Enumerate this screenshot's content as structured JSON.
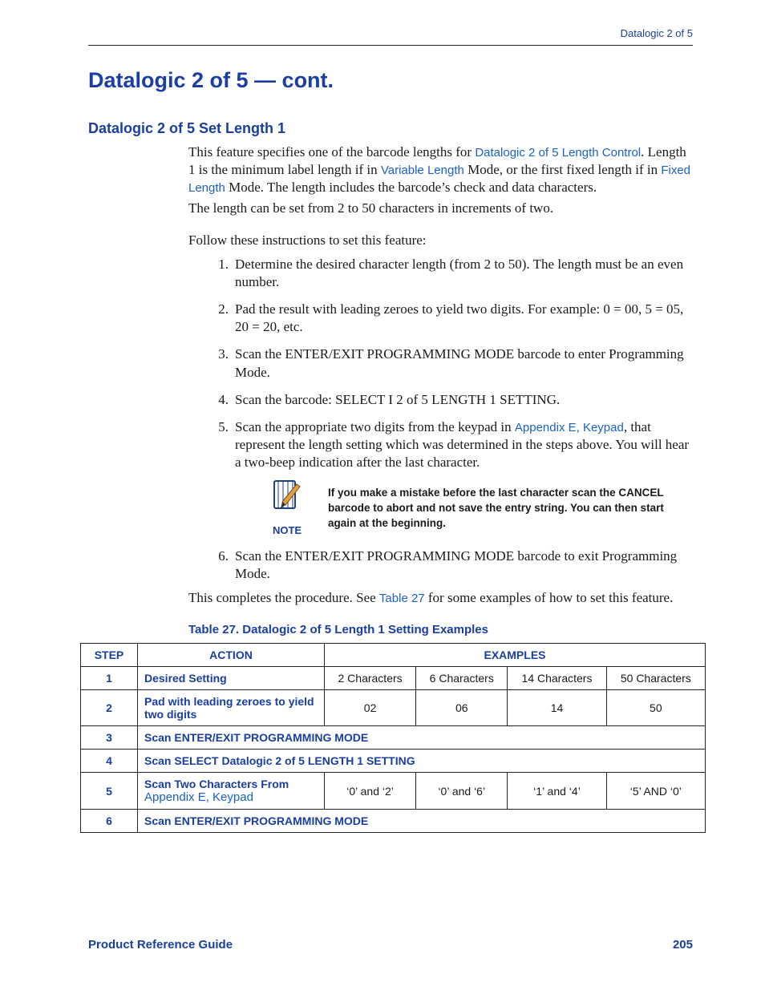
{
  "header": {
    "running": "Datalogic 2 of 5"
  },
  "titles": {
    "main": "Datalogic 2 of 5 — cont.",
    "sub": "Datalogic 2 of 5 Set Length 1"
  },
  "links": {
    "length_control": "Datalogic 2 of 5 Length Control",
    "variable_length": "Variable Length",
    "fixed_length": "Fixed Length",
    "appendix_e": "Appendix E, Keypad",
    "table27": "Table 27"
  },
  "body": {
    "p1a": "This feature specifies one of the barcode lengths for ",
    "p1b": ". Length 1 is the minimum label length if in ",
    "p1c": " Mode, or the first fixed length if in ",
    "p1d": " Mode. The length includes the barcode’s check and data characters.",
    "p2": "The length can be set from 2 to 50 characters in increments of two.",
    "p3": "Follow these instructions to set this feature:",
    "li1": "Determine the desired character length (from 2 to 50). The length must be an even number.",
    "li2": "Pad the result with leading zeroes to yield two digits. For example: 0 = 00, 5 = 05, 20 = 20, etc.",
    "li3": "Scan the ENTER/EXIT PROGRAMMING MODE barcode to enter Programming Mode.",
    "li4": "Scan the barcode: SELECT I 2 of 5 LENGTH 1 SETTING.",
    "li5a": "Scan the appropriate two digits from the keypad in ",
    "li5b": ", that represent the length setting which was determined in the steps above. You will hear a two-beep indication after the last character.",
    "li6": "Scan the ENTER/EXIT PROGRAMMING MODE barcode to exit Programming Mode.",
    "closing_a": "This completes the procedure. See ",
    "closing_b": " for some examples of how to set this feature."
  },
  "note": {
    "label": "NOTE",
    "text": "If you make a mistake before the last character scan the CANCEL barcode to abort and not save the entry string. You can then start again at the beginning."
  },
  "table": {
    "title": "Table 27. Datalogic 2 of 5 Length 1 Setting Examples",
    "headers": {
      "step": "STEP",
      "action": "ACTION",
      "examples": "EXAMPLES"
    },
    "rows": [
      {
        "step": "1",
        "action": "Desired Setting",
        "ex": [
          "2 Characters",
          "6 Characters",
          "14 Characters",
          "50 Characters"
        ]
      },
      {
        "step": "2",
        "action": "Pad with leading zeroes to yield two digits",
        "ex": [
          "02",
          "06",
          "14",
          "50"
        ]
      },
      {
        "step": "3",
        "action_full": "Scan ENTER/EXIT PROGRAMMING MODE"
      },
      {
        "step": "4",
        "action_full": "Scan SELECT Datalogic 2 of 5 LENGTH 1 SETTING"
      },
      {
        "step": "5",
        "action_pre": "Scan Two Characters From ",
        "action_link": "Appendix E, Keypad",
        "ex": [
          "‘0’ and ‘2’",
          "‘0’ and ‘6’",
          "‘1’ and ‘4’",
          "‘5’ AND ‘0’"
        ]
      },
      {
        "step": "6",
        "action_full": "Scan ENTER/EXIT PROGRAMMING MODE"
      }
    ]
  },
  "footer": {
    "left": "Product Reference Guide",
    "right": "205"
  }
}
